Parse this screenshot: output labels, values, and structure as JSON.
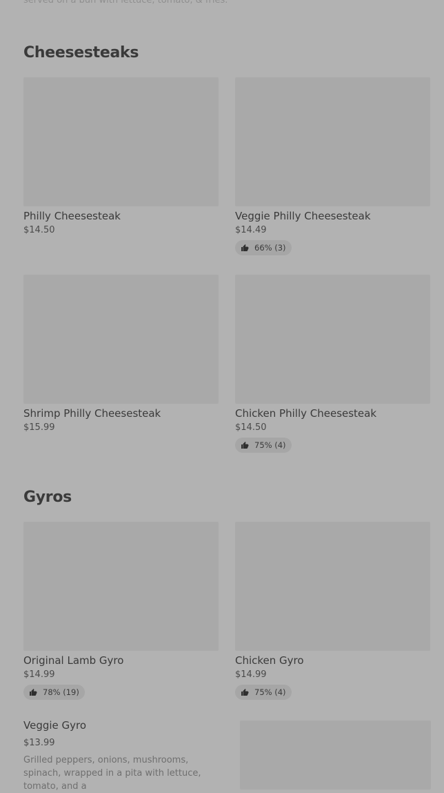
{
  "top_description": "served on a bun with lettuce, tomato, & fries.",
  "sections": [
    {
      "title": "Cheesesteaks",
      "items": [
        {
          "name": "Philly Cheesesteak",
          "price": "$14.50",
          "rating": ""
        },
        {
          "name": "Veggie Philly Cheesesteak",
          "price": "$14.49",
          "rating": "66% (3)"
        },
        {
          "name": "Shrimp Philly Cheesesteak",
          "price": "$15.99",
          "rating": ""
        },
        {
          "name": "Chicken Philly Cheesesteak",
          "price": "$14.50",
          "rating": "75% (4)"
        }
      ]
    },
    {
      "title": "Gyros",
      "items": [
        {
          "name": "Original Lamb Gyro",
          "price": "$14.99",
          "rating": "78% (19)"
        },
        {
          "name": "Chicken Gyro",
          "price": "$14.99",
          "rating": "75% (4)"
        }
      ],
      "list_items": [
        {
          "name": "Veggie Gyro",
          "price": "$13.99",
          "description": "Grilled peppers, onions, mushrooms, spinach, wrapped in a pita with lettuce, tomato, and a"
        }
      ]
    }
  ],
  "icons": {
    "rating": "thumbs-up-icon"
  }
}
